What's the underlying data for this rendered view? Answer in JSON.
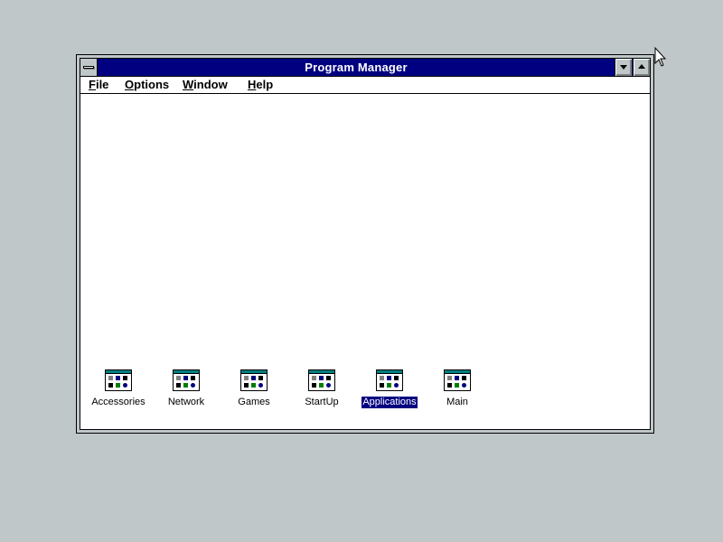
{
  "window": {
    "title": "Program Manager"
  },
  "menu": [
    {
      "label": "File",
      "underline": "F",
      "rest": "ile"
    },
    {
      "label": "Options",
      "underline": "O",
      "rest": "ptions"
    },
    {
      "label": "Window",
      "underline": "W",
      "rest": "indow"
    },
    {
      "label": "Help",
      "underline": "H",
      "rest": "elp"
    }
  ],
  "groups": [
    {
      "label": "Accessories",
      "selected": false
    },
    {
      "label": "Network",
      "selected": false
    },
    {
      "label": "Games",
      "selected": false
    },
    {
      "label": "StartUp",
      "selected": false
    },
    {
      "label": "Applications",
      "selected": true
    },
    {
      "label": "Main",
      "selected": false
    }
  ],
  "colors": {
    "desktop": "#c0c7c8",
    "titlebar": "#000080",
    "selection": "#000080"
  }
}
